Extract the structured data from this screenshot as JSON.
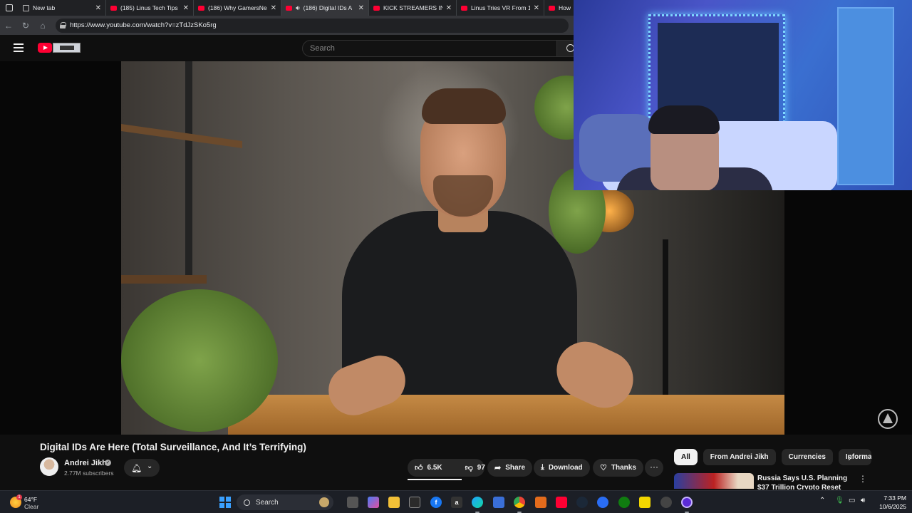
{
  "browser": {
    "tabs": [
      {
        "label": "New tab",
        "active": false,
        "kind": "doc"
      },
      {
        "label": "(185) Linus Tech Tips -",
        "active": false,
        "kind": "youtube"
      },
      {
        "label": "(186) Why GamersNex",
        "active": false,
        "kind": "youtube"
      },
      {
        "label": "(186) Digital IDs A",
        "active": true,
        "kind": "youtube"
      },
      {
        "label": "KICK STREAMERS IN S(",
        "active": false,
        "kind": "youtube"
      },
      {
        "label": "Linus Tries VR From 19!",
        "active": false,
        "kind": "youtube"
      },
      {
        "label": "How",
        "active": false,
        "kind": "youtube"
      }
    ],
    "url": "https://www.youtube.com/watch?v=zTdJzSKo5rg"
  },
  "masthead": {
    "search_placeholder": "Search"
  },
  "video": {
    "title": "Digital IDs Are Here (Total Surveillance, And It’s Terrifying)",
    "channel_name": "Andrei Jikh",
    "subscribers": "2.77M subscribers",
    "likes": "6.5K",
    "dislikes": "97",
    "share_label": "Share",
    "download_label": "Download",
    "thanks_label": "Thanks",
    "more_label": "···"
  },
  "chips": [
    {
      "label": "All",
      "selected": true
    },
    {
      "label": "From Andrei Jikh",
      "selected": false
    },
    {
      "label": "Currencies",
      "selected": false
    },
    {
      "label": "Informa",
      "selected": false
    }
  ],
  "recommendation": {
    "title": "Russia Says U.S. Planning $37 Trillion Crypto Reset"
  },
  "taskbar": {
    "weather_temp": "64°F",
    "weather_condition": "Clear",
    "weather_badge": "1",
    "search_label": "Search",
    "time": "7:33 PM",
    "date": "10/6/2025"
  },
  "colors": {
    "youtube_red": "#ff0033",
    "background": "#0f0f0f",
    "chip_selected": "#f1f1f1"
  }
}
